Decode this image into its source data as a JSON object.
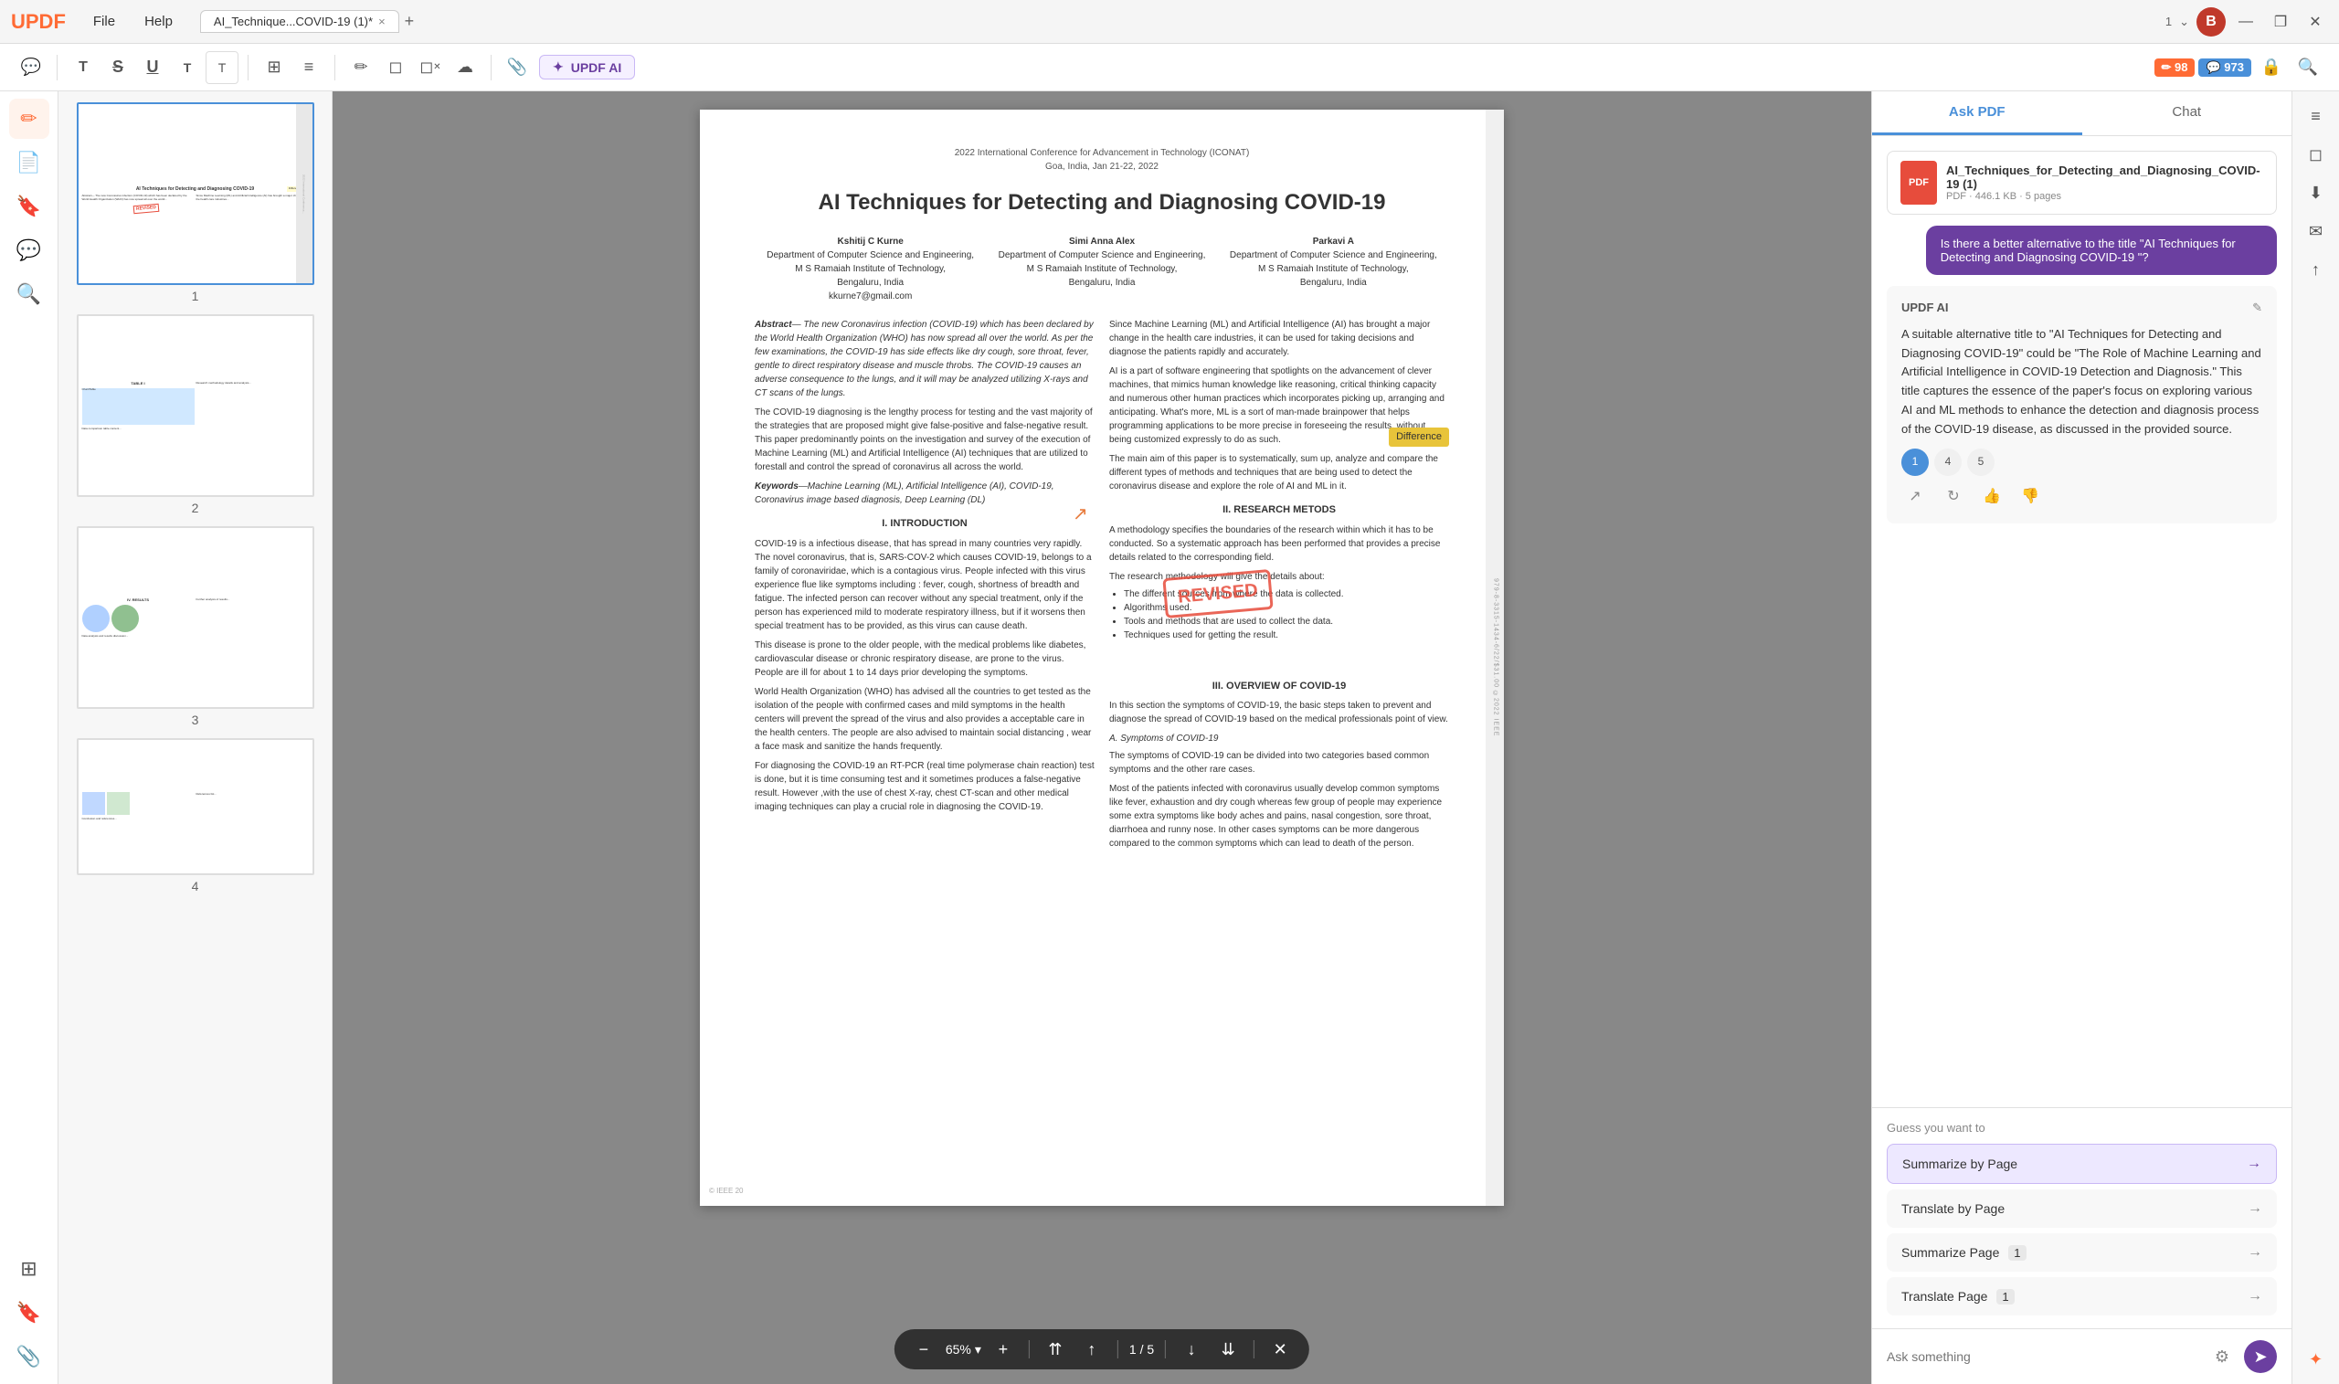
{
  "app": {
    "name": "UPDF",
    "logo": "UPDF"
  },
  "titlebar": {
    "menu": [
      "File",
      "Help"
    ],
    "tab_label": "AI_Technique...COVID-19 (1)*",
    "tab_close": "×",
    "tab_add": "+",
    "page_indicator": "1 / 5",
    "avatar_letter": "B",
    "window_minimize": "—",
    "window_maximize": "❐",
    "window_close": "✕"
  },
  "toolbar": {
    "tools": [
      "💬",
      "T",
      "S̶",
      "U̲",
      "T",
      "T",
      "⊞",
      "≡",
      "A",
      "◻",
      "✏",
      "☁"
    ],
    "updf_ai_label": "UPDF AI",
    "badge_left": "98",
    "badge_right": "973",
    "badge_lock": "🔒",
    "search_icon": "🔍"
  },
  "left_sidebar": {
    "icons": [
      "📄",
      "✏",
      "📝",
      "📊",
      "🔖",
      "📎"
    ]
  },
  "thumbnails": [
    {
      "number": "1",
      "selected": true
    },
    {
      "number": "2",
      "selected": false
    },
    {
      "number": "3",
      "selected": false
    },
    {
      "number": "4",
      "selected": false
    }
  ],
  "pdf": {
    "conference": "2022 International Conference for Advancement in Technology (ICONAT)",
    "location": "Goa, India, Jan 21-22, 2022",
    "title": "AI Techniques for Detecting and Diagnosing COVID-19",
    "authors": [
      {
        "name": "Kshitij C Kurne",
        "dept": "Department of Computer Science and Engineering,",
        "institute": "M S Ramaiah Institute of Technology,",
        "city": "Bengaluru, India",
        "email": "kkurne7@gmail.com"
      },
      {
        "name": "Simi Anna Alex",
        "dept": "Department of Computer Science and Engineering,",
        "institute": "M S Ramaiah Institute of Technology,",
        "city": "Bengaluru, India",
        "email": ""
      },
      {
        "name": "Parkavi A",
        "dept": "Department of Computer Science and Engineering,",
        "institute": "M S Ramaiah Institute of Technology,",
        "city": "Bengaluru, India",
        "email": ""
      }
    ],
    "sections": {
      "abstract_label": "Abstract",
      "keywords_label": "Keywords",
      "keywords": "Machine Learning (ML), Artificial Intelligence (AI), COVID-19, Coronavirus image based diagnosis, Deep Learning (DL)",
      "intro_label": "I. INTRODUCTION",
      "research_label": "II. RESEARCH METODS",
      "overview_label": "III. OVERVIEW OF COVID-19"
    },
    "page_number": "1 / 5",
    "zoom_level": "65%",
    "stamp": "REVISED",
    "diff_badge": "Difference",
    "copyright": "© IEEE 20"
  },
  "bottom_toolbar": {
    "zoom_out": "−",
    "zoom_level": "65%",
    "zoom_dropdown": "▾",
    "zoom_in": "+",
    "scroll_up": "↑",
    "scroll_top": "⇈",
    "page_display": "1 / 5",
    "scroll_down": "↓",
    "scroll_bottom": "⇊",
    "close": "✕"
  },
  "ai_panel": {
    "tabs": [
      "Ask PDF",
      "Chat"
    ],
    "active_tab": "Ask PDF",
    "file": {
      "icon_text": "PDF",
      "name": "AI_Techniques_for_Detecting_and_Diagnosing_COVID-19 (1)",
      "meta": "PDF · 446.1 KB · 5 pages"
    },
    "user_message": "Is there a better alternative to the title \"AI Techniques for Detecting and Diagnosing COVID-19 \"?",
    "ai_label": "UPDF AI",
    "ai_response": "A suitable alternative title to \"AI Techniques for Detecting and Diagnosing COVID-19\" could be \"The Role of Machine Learning and Artificial Intelligence in COVID-19 Detection and Diagnosis.\" This title captures the essence of the paper's focus on exploring various AI and ML methods to enhance the detection and diagnosis process of the COVID-19 disease, as discussed in the provided source.",
    "page_chips": [
      "1",
      "4",
      "5"
    ],
    "active_chip": "1",
    "action_icons": [
      "↗",
      "↻",
      "👍",
      "👎"
    ],
    "guess_section": {
      "title": "Guess you want to",
      "items": [
        {
          "label": "Summarize by Page",
          "highlighted": true
        },
        {
          "label": "Translate by Page",
          "highlighted": false
        },
        {
          "label": "Summarize Page",
          "suffix": "1",
          "highlighted": false
        },
        {
          "label": "Translate Page",
          "suffix": "1",
          "highlighted": false
        }
      ]
    },
    "ask_placeholder": "Ask something",
    "ask_icon": "⚙",
    "send_icon": "➤"
  },
  "far_right_sidebar": {
    "icons": [
      "≡",
      "👁",
      "⬇",
      "📧",
      "◻",
      "🌐"
    ]
  }
}
